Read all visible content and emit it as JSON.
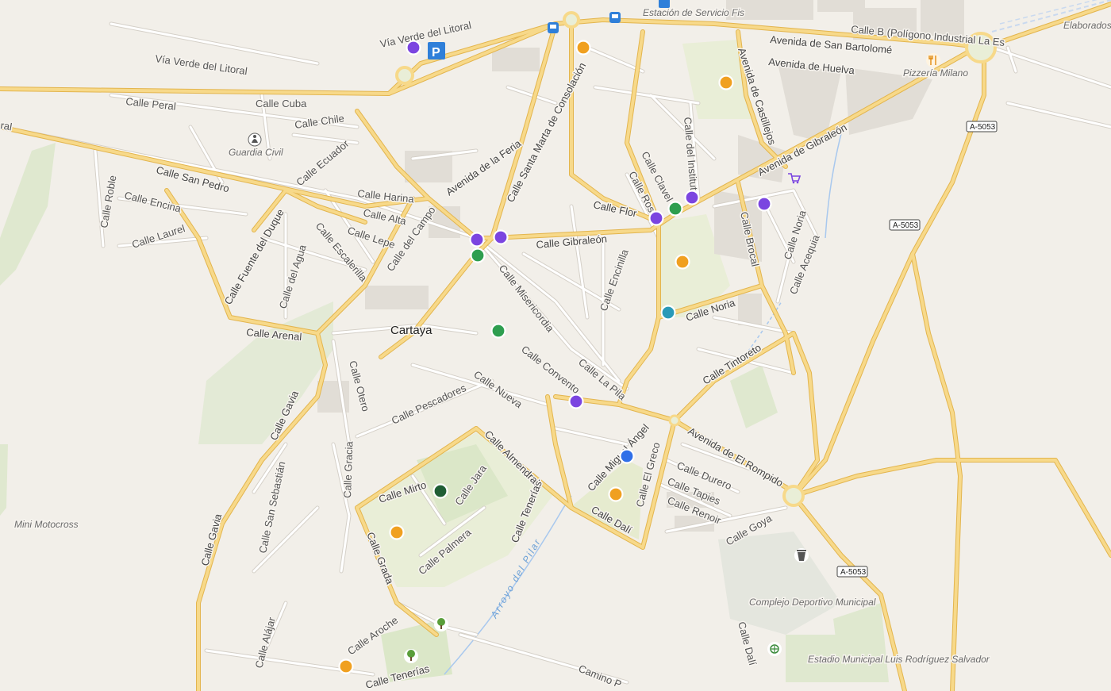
{
  "map": {
    "place_label": "Cartaya",
    "colors": {
      "background": "#f2efe9",
      "major_road": "#f5d27a",
      "major_road_casing": "#e3b54e",
      "minor_road": "#ffffff",
      "minor_road_casing": "#d8d4cc",
      "park": "#e9eed7",
      "green": "#d9e8c7",
      "building": "#e3dfd8",
      "water": "#a8c8ee",
      "marker_purple": "#7b45e0",
      "marker_orange": "#f0a020",
      "marker_green": "#2e9e4f",
      "marker_darkgreen": "#1f5e34",
      "marker_teal": "#2a9ab8",
      "marker_blue": "#2f6fe8"
    },
    "streets": [
      {
        "id": "via-verde-1",
        "label": "Vía Verde del Litoral"
      },
      {
        "id": "via-verde-2",
        "label": "Vía Verde del Litoral"
      },
      {
        "id": "calle-peral",
        "label": "Calle Peral"
      },
      {
        "id": "calle-cuba",
        "label": "Calle Cuba"
      },
      {
        "id": "calle-chile",
        "label": "Calle Chile"
      },
      {
        "id": "calle-ecuador",
        "label": "Calle Ecuador"
      },
      {
        "id": "calle-san-pedro",
        "label": "Calle San Pedro"
      },
      {
        "id": "calle-roble",
        "label": "Calle Roble"
      },
      {
        "id": "calle-encina",
        "label": "Calle Encina"
      },
      {
        "id": "calle-laurel",
        "label": "Calle Laurel"
      },
      {
        "id": "calle-harina",
        "label": "Calle Harina"
      },
      {
        "id": "calle-alta",
        "label": "Calle Alta"
      },
      {
        "id": "calle-lepe",
        "label": "Calle Lepe"
      },
      {
        "id": "calle-escalerilla",
        "label": "Calle Escalerilla"
      },
      {
        "id": "calle-fuente-duque",
        "label": "Calle Fuente del Duque"
      },
      {
        "id": "calle-del-agua",
        "label": "Calle del Agua"
      },
      {
        "id": "calle-del-campo",
        "label": "Calle del Campo"
      },
      {
        "id": "avenida-feria",
        "label": "Avenida de la Feria"
      },
      {
        "id": "calle-santa-marta",
        "label": "Calle Santa Marta de Consolación"
      },
      {
        "id": "calle-gibraleon",
        "label": "Calle Gibraleón"
      },
      {
        "id": "calle-misericordia",
        "label": "Calle Misericordia"
      },
      {
        "id": "calle-arenal",
        "label": "Calle Arenal"
      },
      {
        "id": "calle-otero",
        "label": "Calle Otero"
      },
      {
        "id": "calle-gavia-1",
        "label": "Calle Gavia"
      },
      {
        "id": "calle-gavia-2",
        "label": "Calle Gavia"
      },
      {
        "id": "calle-pescadores",
        "label": "Calle Pescadores"
      },
      {
        "id": "calle-nueva",
        "label": "Calle Nueva"
      },
      {
        "id": "calle-convento",
        "label": "Calle Convento"
      },
      {
        "id": "calle-la-pila",
        "label": "Calle La Pila"
      },
      {
        "id": "calle-encinilla",
        "label": "Calle Encinilla"
      },
      {
        "id": "calle-flor",
        "label": "Calle Flor"
      },
      {
        "id": "calle-rosal",
        "label": "Calle Rosal"
      },
      {
        "id": "calle-clavel",
        "label": "Calle Clavel"
      },
      {
        "id": "calle-instituto",
        "label": "Calle del Instituto"
      },
      {
        "id": "avenida-castillejos",
        "label": "Avenida de Castillejos"
      },
      {
        "id": "avenida-gibraleon",
        "label": "Avenida de Gibraleón"
      },
      {
        "id": "avenida-san-bartolome",
        "label": "Avenida de San Bartolomé"
      },
      {
        "id": "avenida-huelva",
        "label": "Avenida de Huelva"
      },
      {
        "id": "calle-b-poligono",
        "label": "Calle B (Polígono Industrial La Es"
      },
      {
        "id": "calle-brocal",
        "label": "Calle Brocal"
      },
      {
        "id": "calle-noria-1",
        "label": "Calle Noria"
      },
      {
        "id": "calle-noria-2",
        "label": "Calle Noria"
      },
      {
        "id": "calle-acequia",
        "label": "Calle Acequia"
      },
      {
        "id": "calle-tintoreto",
        "label": "Calle Tintoreto"
      },
      {
        "id": "avenida-rompido",
        "label": "Avenida de El Rompido"
      },
      {
        "id": "calle-miguel-angel",
        "label": "Calle Miguel Ángel"
      },
      {
        "id": "calle-el-greco",
        "label": "Calle El Greco"
      },
      {
        "id": "calle-durero",
        "label": "Calle Durero"
      },
      {
        "id": "calle-tapies",
        "label": "Calle Tapies"
      },
      {
        "id": "calle-renoir",
        "label": "Calle Renoir"
      },
      {
        "id": "calle-goya",
        "label": "Calle Goya"
      },
      {
        "id": "calle-dali-1",
        "label": "Calle Dalí"
      },
      {
        "id": "calle-dali-2",
        "label": "Calle Dalí"
      },
      {
        "id": "calle-almendral",
        "label": "Calle Almendral"
      },
      {
        "id": "calle-tenerias-1",
        "label": "Calle Tenerías"
      },
      {
        "id": "calle-tenerias-2",
        "label": "Calle Tenerías"
      },
      {
        "id": "calle-mirto",
        "label": "Calle Mirto"
      },
      {
        "id": "calle-jara",
        "label": "Calle Jara"
      },
      {
        "id": "calle-gracia",
        "label": "Calle Gracia"
      },
      {
        "id": "calle-grada",
        "label": "Calle Grada"
      },
      {
        "id": "calle-palmera",
        "label": "Calle Palmera"
      },
      {
        "id": "calle-aroche",
        "label": "Calle Aroche"
      },
      {
        "id": "calle-alajar",
        "label": "Calle Alájar"
      },
      {
        "id": "calle-san-sebastian",
        "label": "Calle San Sebastián"
      },
      {
        "id": "camino-p",
        "label": "Camino P"
      },
      {
        "id": "calle-real-cut",
        "label": "ral"
      }
    ],
    "water_label": "Arroyo del Pilar",
    "pois": [
      {
        "id": "guardia-civil",
        "label": "Guardia Civil",
        "icon": "police-icon"
      },
      {
        "id": "estacion-servicio",
        "label": "Estación de Servicio Fis",
        "icon": "fuel-icon"
      },
      {
        "id": "pizzeria",
        "label": "Pizzería Milano",
        "icon": "restaurant-icon"
      },
      {
        "id": "elaborados",
        "label": "Elaborados",
        "icon": ""
      },
      {
        "id": "mini-motocross",
        "label": "Mini Motocross",
        "icon": ""
      },
      {
        "id": "complejo",
        "label": "Complejo Deportivo Municipal",
        "icon": ""
      },
      {
        "id": "estadio",
        "label": "Estadio Municipal Luis Rodríguez Salvador",
        "icon": "sports-icon"
      }
    ],
    "road_shields": [
      "A-5053",
      "A-5053",
      "A-5053"
    ],
    "markers": [
      {
        "id": "m1",
        "category": "purple"
      },
      {
        "id": "m2",
        "category": "orange"
      },
      {
        "id": "m3",
        "category": "orange"
      },
      {
        "id": "m4",
        "category": "purple"
      },
      {
        "id": "m5",
        "category": "purple"
      },
      {
        "id": "m6",
        "category": "green"
      },
      {
        "id": "m7",
        "category": "purple"
      },
      {
        "id": "m8",
        "category": "purple"
      },
      {
        "id": "m9",
        "category": "green"
      },
      {
        "id": "m10",
        "category": "orange"
      },
      {
        "id": "m11",
        "category": "teal"
      },
      {
        "id": "m12",
        "category": "green"
      },
      {
        "id": "m13",
        "category": "purple"
      },
      {
        "id": "m14",
        "category": "blue"
      },
      {
        "id": "m15",
        "category": "orange"
      },
      {
        "id": "m16",
        "category": "darkgreen"
      },
      {
        "id": "m17",
        "category": "orange"
      },
      {
        "id": "m18",
        "category": "orange"
      },
      {
        "id": "m19",
        "category": "purple"
      }
    ],
    "icons": [
      "parking-icon",
      "bus-stop-icon",
      "bus-stop-icon",
      "fuel-icon",
      "shopping-cart-icon",
      "restaurant-icon",
      "police-icon",
      "waste-icon",
      "tree-icon",
      "tree-icon",
      "sports-icon"
    ]
  }
}
